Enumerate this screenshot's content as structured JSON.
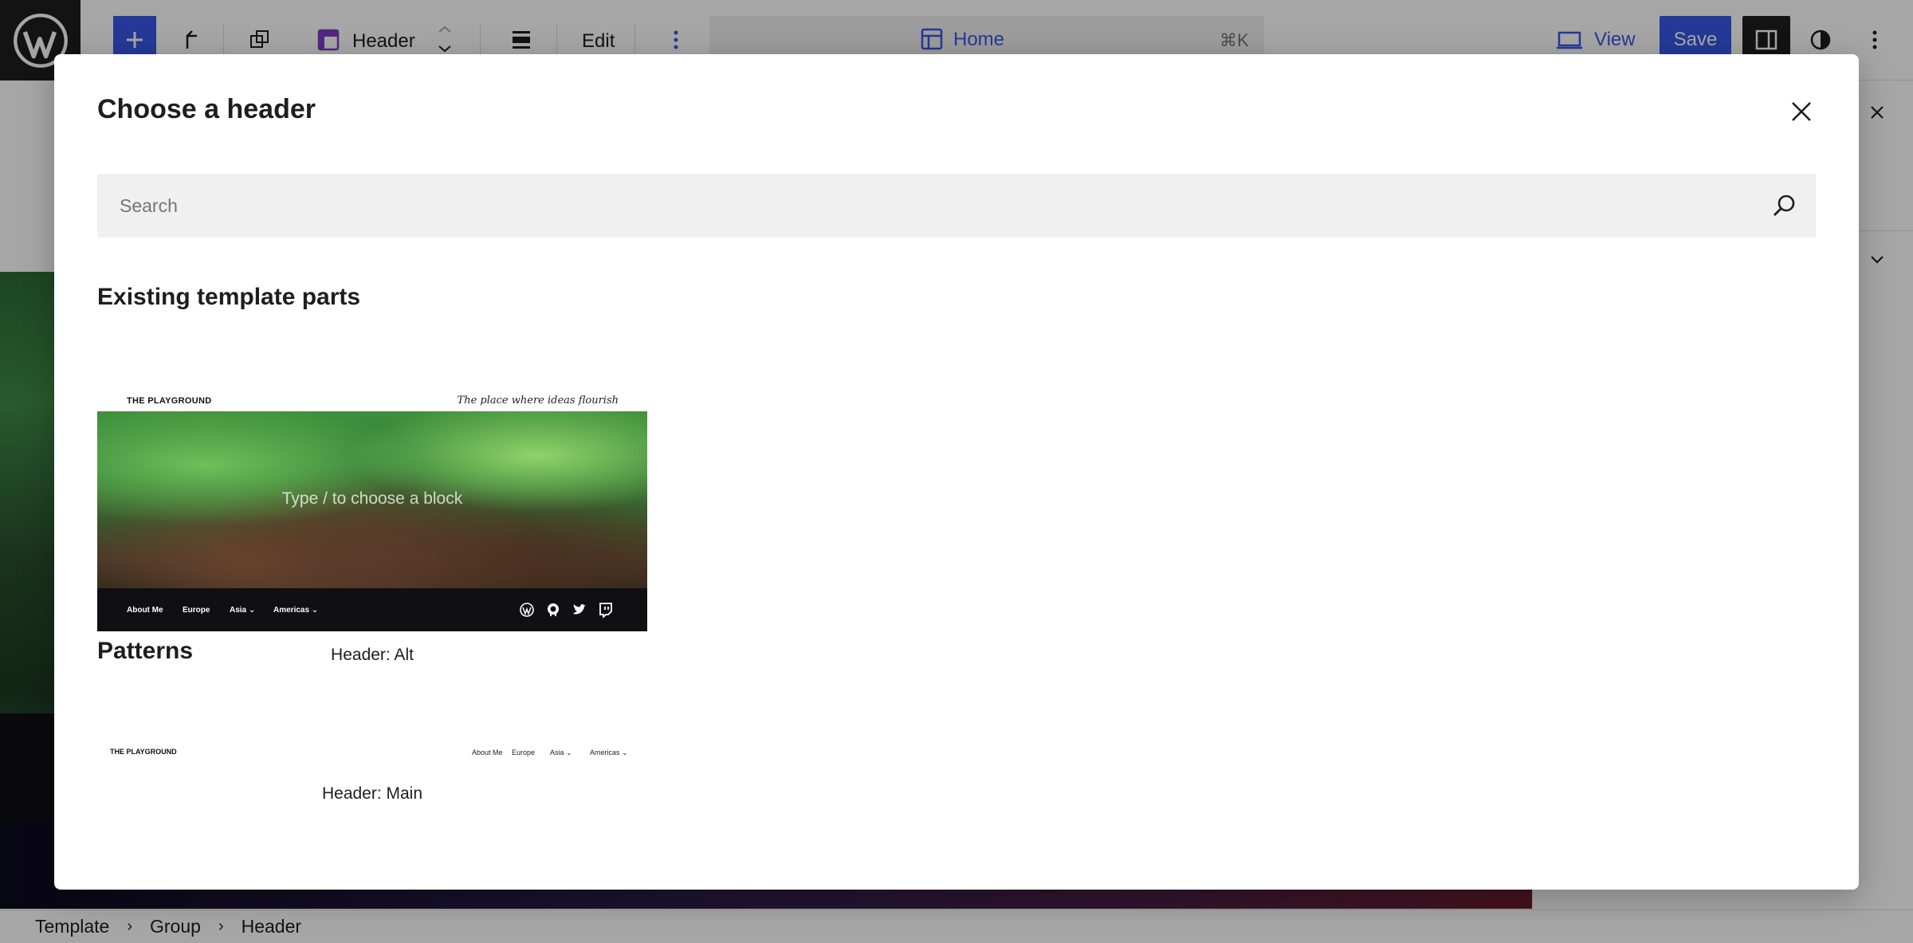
{
  "toolbar": {
    "block_name": "Header",
    "edit_label": "Edit",
    "command_title": "Home",
    "command_shortcut": "⌘K",
    "view_label": "View",
    "save_label": "Save"
  },
  "breadcrumb": [
    "Template",
    "Group",
    "Header"
  ],
  "modal": {
    "title": "Choose a header",
    "search_placeholder": "Search",
    "existing_heading": "Existing template parts",
    "patterns_heading": "Patterns",
    "existing_parts": [
      {
        "label": "Header: Alt",
        "preview": {
          "site_title": "THE PLAYGROUND",
          "tagline": "The place where ideas flourish",
          "prompt": "Type / to choose a block",
          "nav": [
            "About Me",
            "Europe",
            "Asia ⌄",
            "Americas ⌄"
          ],
          "social_icons": [
            "wordpress-icon",
            "github-icon",
            "twitter-icon",
            "twitch-icon"
          ]
        }
      }
    ],
    "patterns": [
      {
        "label": "Header: Main",
        "preview": {
          "site_title": "THE PLAYGROUND",
          "nav": [
            "About Me",
            "Europe",
            "Asia ⌄",
            "Americas ⌄"
          ]
        }
      }
    ]
  },
  "colors": {
    "accent": "#3858e9",
    "text": "#1e1e1e",
    "muted": "#757575",
    "search_bg": "#f0f0f0"
  }
}
